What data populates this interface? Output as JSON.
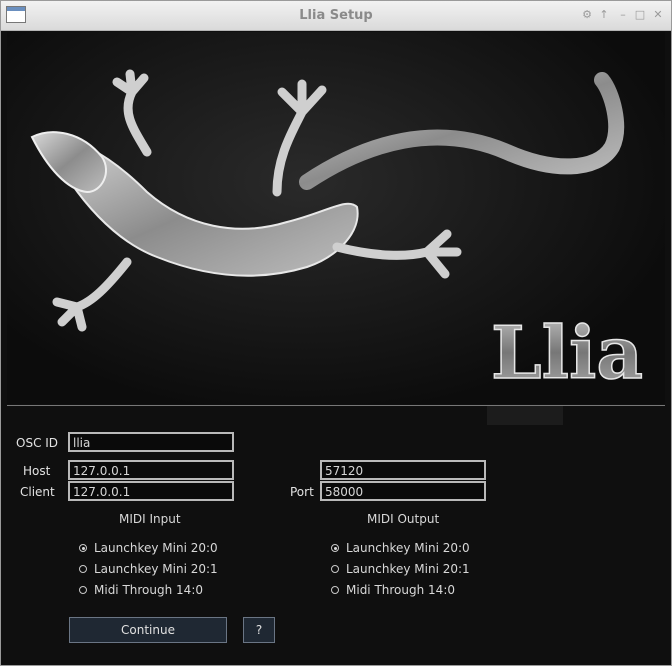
{
  "window": {
    "title": "Llia Setup",
    "controls": [
      "gear-icon",
      "up-arrow-icon",
      "minimize-icon",
      "maximize-icon",
      "close-icon"
    ]
  },
  "banner": {
    "logo_text": "Llia"
  },
  "form": {
    "osc_id_label": "OSC ID",
    "osc_id_value": "llia",
    "host_label": "Host",
    "host_value": "127.0.0.1",
    "client_label": "Client",
    "client_value": "127.0.0.1",
    "port_label": "Port",
    "host_port_value": "57120",
    "client_port_value": "58000"
  },
  "midi_input": {
    "title": "MIDI Input",
    "options": [
      {
        "label": "Launchkey Mini 20:0",
        "selected": true
      },
      {
        "label": "Launchkey Mini 20:1",
        "selected": false
      },
      {
        "label": "Midi Through 14:0",
        "selected": false
      }
    ]
  },
  "midi_output": {
    "title": "MIDI Output",
    "options": [
      {
        "label": "Launchkey Mini 20:0",
        "selected": true
      },
      {
        "label": "Launchkey Mini 20:1",
        "selected": false
      },
      {
        "label": "Midi Through 14:0",
        "selected": false
      }
    ]
  },
  "buttons": {
    "continue_label": "Continue",
    "help_label": "?"
  },
  "colors": {
    "background": "#0f0f0f",
    "button_bg": "#1f2833",
    "field_border": "#b9b9b9"
  }
}
